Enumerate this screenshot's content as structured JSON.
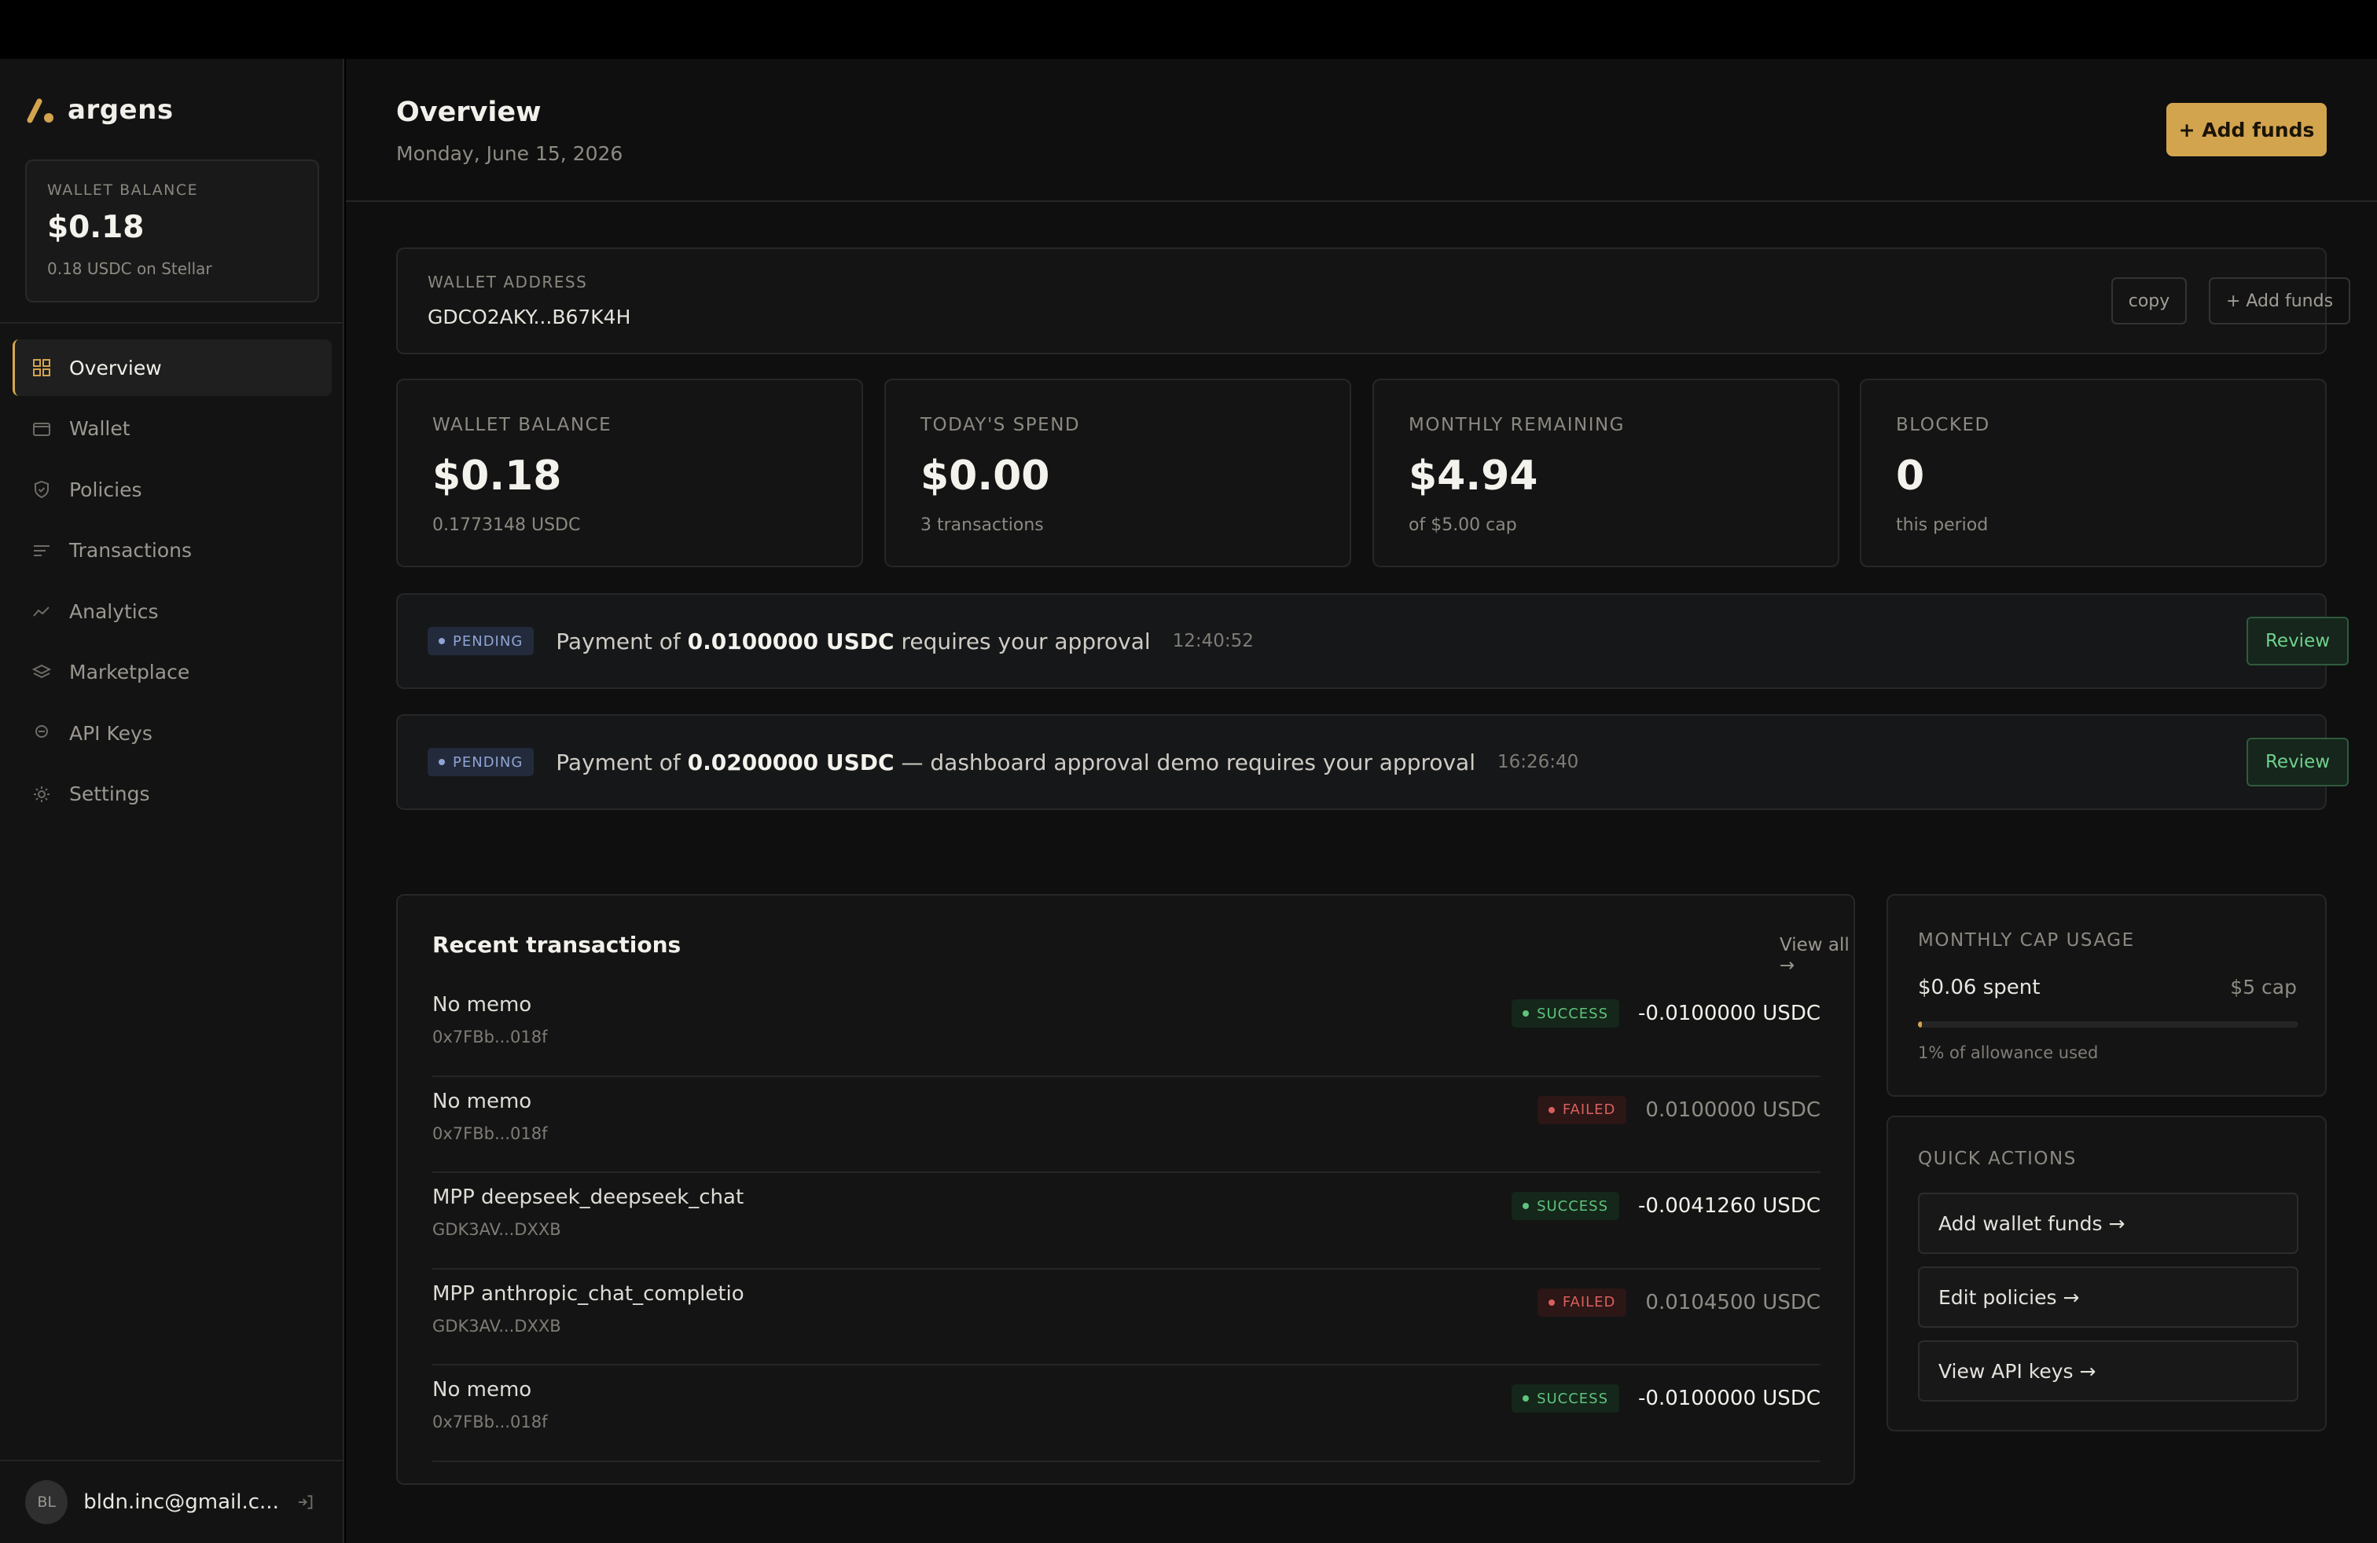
{
  "app": {
    "name": "argens"
  },
  "sidebar": {
    "wallet": {
      "label": "WALLET BALANCE",
      "value": "$0.18",
      "sub": "0.18 USDC on Stellar"
    },
    "items": [
      {
        "label": "Overview",
        "icon": "grid-icon",
        "active": true
      },
      {
        "label": "Wallet",
        "icon": "wallet-icon"
      },
      {
        "label": "Policies",
        "icon": "shield-icon"
      },
      {
        "label": "Transactions",
        "icon": "list-icon"
      },
      {
        "label": "Analytics",
        "icon": "chart-line-icon"
      },
      {
        "label": "Marketplace",
        "icon": "layers-icon"
      },
      {
        "label": "API Keys",
        "icon": "key-icon"
      },
      {
        "label": "Settings",
        "icon": "gear-icon"
      }
    ],
    "user": {
      "initials": "BL",
      "email": "bldn.inc@gmail.c..."
    }
  },
  "header": {
    "title": "Overview",
    "date": "Monday, June 15, 2026",
    "add_funds": "+ Add funds"
  },
  "address": {
    "label": "WALLET ADDRESS",
    "value": "GDCO2AKY...B67K4H",
    "copy": "copy",
    "add_funds": "+ Add funds"
  },
  "stats": [
    {
      "label": "WALLET BALANCE",
      "value": "$0.18",
      "sub": "0.1773148 USDC"
    },
    {
      "label": "TODAY'S SPEND",
      "value": "$0.00",
      "sub": "3 transactions"
    },
    {
      "label": "MONTHLY REMAINING",
      "value": "$4.94",
      "sub": "of $5.00 cap"
    },
    {
      "label": "BLOCKED",
      "value": "0",
      "sub": "this period"
    }
  ],
  "pending": [
    {
      "badge": "PENDING",
      "prefix": "Payment of ",
      "amount": "0.0100000 USDC",
      "suffix": " requires your approval",
      "time": "12:40:52",
      "action": "Review"
    },
    {
      "badge": "PENDING",
      "prefix": "Payment of ",
      "amount": "0.0200000 USDC",
      "suffix": " — dashboard approval demo requires your approval",
      "time": "16:26:40",
      "action": "Review"
    }
  ],
  "transactions": {
    "title": "Recent transactions",
    "view_all": "View all →",
    "rows": [
      {
        "name": "No memo",
        "addr": "0x7FBb...018f",
        "status": "SUCCESS",
        "amount": "-0.0100000 USDC"
      },
      {
        "name": "No memo",
        "addr": "0x7FBb...018f",
        "status": "FAILED",
        "amount": "0.0100000 USDC"
      },
      {
        "name": "MPP deepseek_deepseek_chat",
        "addr": "GDK3AV...DXXB",
        "status": "SUCCESS",
        "amount": "-0.0041260 USDC"
      },
      {
        "name": "MPP anthropic_chat_completio",
        "addr": "GDK3AV...DXXB",
        "status": "FAILED",
        "amount": "0.0104500 USDC"
      },
      {
        "name": "No memo",
        "addr": "0x7FBb...018f",
        "status": "SUCCESS",
        "amount": "-0.0100000 USDC"
      }
    ]
  },
  "cap": {
    "label": "MONTHLY CAP USAGE",
    "spent": "$0.06 spent",
    "cap": "$5 cap",
    "percent": 1,
    "note": "1% of allowance used"
  },
  "quick_actions": {
    "label": "QUICK ACTIONS",
    "items": [
      "Add wallet funds →",
      "Edit policies →",
      "View API keys →"
    ]
  },
  "colors": {
    "accent": "#d3a44e",
    "success": "#5fc47d",
    "failed": "#d8605c",
    "pending": "#8fa4d4"
  }
}
